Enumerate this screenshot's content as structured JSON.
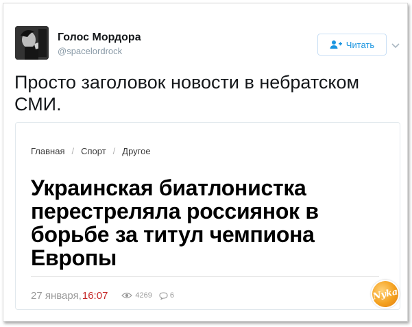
{
  "tweet": {
    "author": {
      "display_name": "Голос Мордора",
      "username": "@spacelordrock",
      "avatar_icon": "avatar-photo"
    },
    "follow_button": {
      "label": "Читать",
      "icon": "follow-person-plus-icon",
      "color": "#1b95e0"
    },
    "menu_icon": "chevron-down-icon",
    "text": "Просто заголовок новости в небратском СМИ."
  },
  "quoted_article": {
    "breadcrumb": [
      "Главная",
      "Спорт",
      "Другое"
    ],
    "breadcrumb_separator": "/",
    "headline": "Украинская биатлонистка перестреляла россиянок в борьбе за титул чемпиона Европы",
    "meta": {
      "date": "27 января,",
      "time": "16:07",
      "time_color": "#c62828",
      "views": "4269",
      "views_icon": "eye-icon",
      "comments": "6",
      "comments_icon": "comment-bubble-icon"
    }
  },
  "watermark": {
    "text": "Nyka",
    "icon": "site-logo"
  }
}
